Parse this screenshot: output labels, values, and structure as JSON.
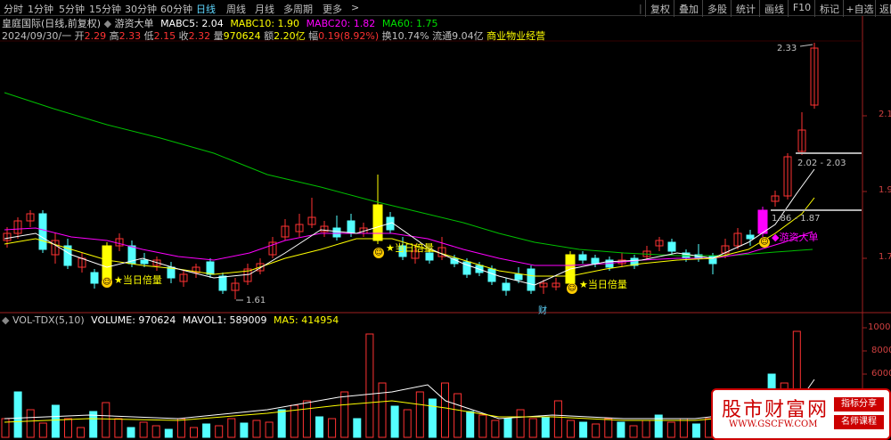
{
  "toolbar": {
    "periods": [
      {
        "label": "分时",
        "active": false
      },
      {
        "label": "1分钟",
        "active": false
      },
      {
        "label": "5分钟",
        "active": false
      },
      {
        "label": "15分钟",
        "active": false
      },
      {
        "label": "30分钟",
        "active": false
      },
      {
        "label": "60分钟",
        "active": false
      },
      {
        "label": "日线",
        "active": true
      },
      {
        "label": "周线",
        "active": false
      },
      {
        "label": "月线",
        "active": false
      },
      {
        "label": "多周期",
        "active": false
      },
      {
        "label": "更多 ",
        "active": false
      }
    ],
    "more_arrow": ">",
    "right_buttons": [
      "复权",
      "叠加",
      "多股",
      "统计",
      "画线",
      "F10",
      "标记",
      "+自选",
      "返回"
    ],
    "separator": "|"
  },
  "info_line1": {
    "stock_name": "皇庭国际(日线,前复权)",
    "indicator_icon": "◆",
    "indicator_name": "游资大单",
    "mabc5": "MABC5: 2.04",
    "mabc10": "MABC10: 1.90",
    "mabc20": "MABC20: 1.82",
    "ma60": "MA60: 1.75"
  },
  "info_line2": {
    "date": "2024/09/30/一",
    "open_label": "开",
    "open": "2.29",
    "high_label": "高",
    "high": "2.33",
    "low_label": "低",
    "low": "2.15",
    "close_label": "收",
    "close": "2.32",
    "volume_label": "量",
    "volume": "970624",
    "amount_label": "额",
    "amount": "2.20亿",
    "change_label": "幅",
    "change": "0.19(8.92%)",
    "turnover": "换10.74%",
    "float": "流通9.04亿",
    "industry": "商业物业经营"
  },
  "price_axis": [
    "2.1",
    "1.9",
    "1.7"
  ],
  "annotations": {
    "high_mark": "2.33",
    "low_mark": "1.61",
    "range1": "2.02 - 2.03",
    "range2": "1.86 - 1.87",
    "signal": "当日倍量",
    "big_order": "游资大单",
    "cai_mark": "财"
  },
  "sub_chart": {
    "title": "VOL-TDX(5,10)",
    "volume": "VOLUME: 970624",
    "mavol1": "MAVOL1: 589009",
    "ma5": "MA5: 414954",
    "axis": [
      "10000",
      "8000",
      "6000"
    ]
  },
  "watermark": {
    "title": "股市财富网",
    "url": "WWW.GSCFW.COM",
    "tag1": "指标分享",
    "tag2": "名师课程"
  },
  "colors": {
    "up": "#ff3232",
    "down": "#54ffff",
    "ma5": "#ffffff",
    "ma10": "#ffff00",
    "ma20": "#ff00ff",
    "ma60": "#00c000",
    "signal": "#ffff00",
    "big_order": "#ff00ff"
  }
}
